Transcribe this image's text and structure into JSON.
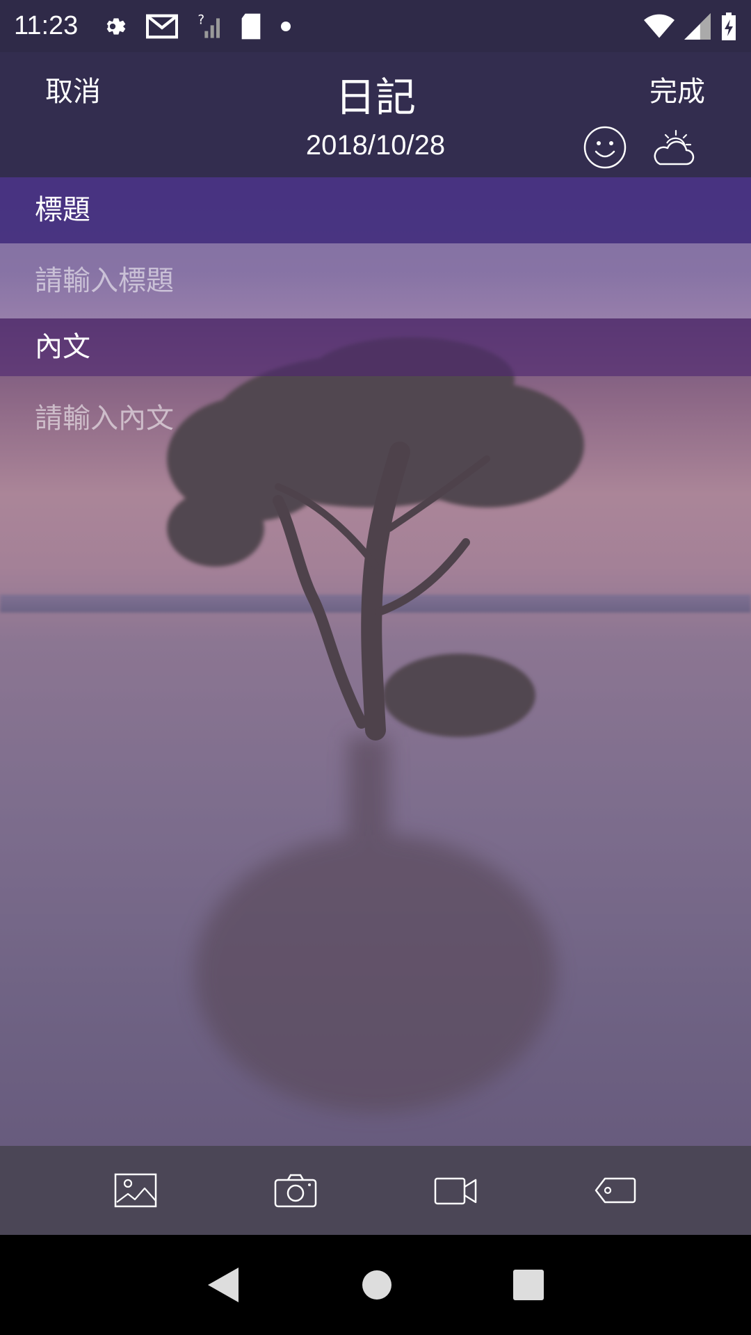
{
  "status_bar": {
    "time": "11:23",
    "icons_left": [
      "settings-icon",
      "mail-icon",
      "no-signal-icon",
      "sd-card-icon",
      "dot-icon"
    ],
    "icons_right": [
      "wifi-icon",
      "signal-icon",
      "battery-charging-icon"
    ]
  },
  "header": {
    "cancel_label": "取消",
    "title": "日記",
    "done_label": "完成",
    "date": "2018/10/28",
    "mood_icon": "smiley-icon",
    "weather_icon": "partly-cloudy-icon"
  },
  "form": {
    "title_label": "標題",
    "title_placeholder": "請輸入標題",
    "body_label": "內文",
    "body_placeholder": "請輸入內文"
  },
  "toolbar": {
    "items": [
      "image-icon",
      "camera-icon",
      "video-icon",
      "tag-icon"
    ]
  },
  "nav": {
    "items": [
      "back-icon",
      "home-icon",
      "recents-icon"
    ]
  },
  "colors": {
    "status_bar": "#2f2a48",
    "header": "#332d4f",
    "section_label": "#46328a",
    "toolbar": "#4b4656"
  }
}
